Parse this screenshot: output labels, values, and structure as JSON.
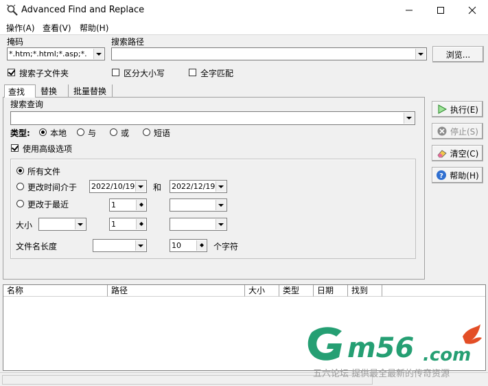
{
  "window": {
    "title": "Advanced Find and Replace"
  },
  "menu": [
    "操作(A)",
    "查看(V)",
    "帮助(H)"
  ],
  "filter": {
    "label": "掩码",
    "value": "*.htm;*.html;*.asp;*."
  },
  "path": {
    "label": "搜索路径",
    "value": ""
  },
  "browse_label": "浏览...",
  "options": {
    "subfolders": {
      "label": "搜索子文件夹",
      "checked": true
    },
    "case": {
      "label": "区分大小写",
      "checked": false
    },
    "whole": {
      "label": "全字匹配",
      "checked": false
    }
  },
  "tabs": [
    "查找",
    "替换",
    "批量替换"
  ],
  "query": {
    "label": "搜索查询",
    "value": ""
  },
  "type": {
    "label": "类型:",
    "options": [
      "本地",
      "与",
      "或",
      "短语"
    ],
    "selected": "本地"
  },
  "advanced": {
    "label": "使用高级选项",
    "checked": true
  },
  "adv": {
    "all_files": "所有文件",
    "modified_between": "更改时间介于",
    "date_from": "2022/10/19",
    "and": "和",
    "date_to": "2022/12/19",
    "modified_recent": "更改于最近",
    "recent_value": "1",
    "size_label": "大小",
    "size_value": "1",
    "name_len_label": "文件名长度",
    "name_len_value": "10",
    "chars_label": "个字符"
  },
  "buttons": {
    "execute": "执行(E)",
    "stop": "停止(S)",
    "clear": "清空(C)",
    "help": "帮助(H)"
  },
  "columns": [
    "名称",
    "路径",
    "大小",
    "类型",
    "日期",
    "找到"
  ],
  "watermark": {
    "logo": "Gm56.com",
    "tagline": "五六论坛 提供最全最新的传奇资源"
  },
  "colors": {
    "accent": "#1a9a6c",
    "watermark_red": "#e2451b"
  }
}
